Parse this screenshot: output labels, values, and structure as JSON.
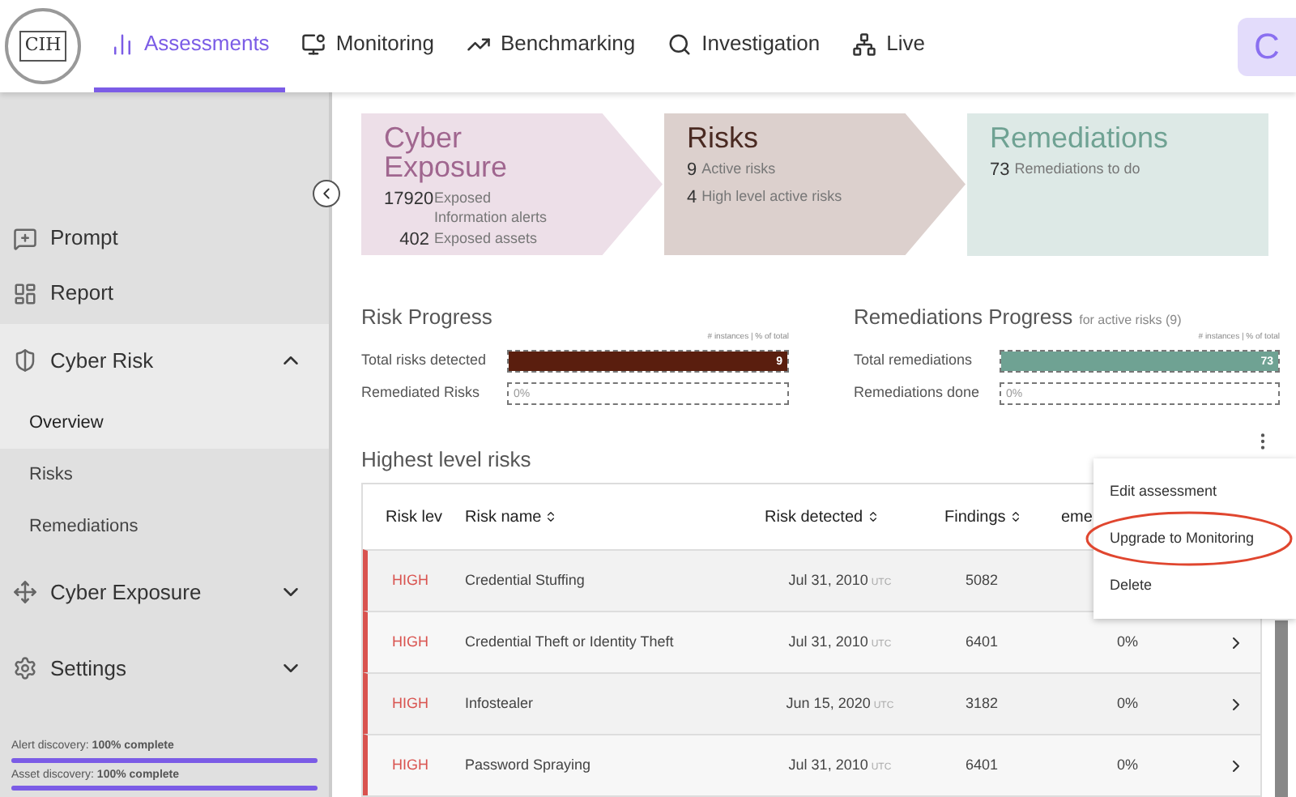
{
  "header": {
    "logo": "CIH",
    "nav": [
      {
        "label": "Assessments",
        "selected": true
      },
      {
        "label": "Monitoring",
        "selected": false
      },
      {
        "label": "Benchmarking",
        "selected": false
      },
      {
        "label": "Investigation",
        "selected": false
      },
      {
        "label": "Live",
        "selected": false
      }
    ],
    "avatar": "C"
  },
  "sidebar": {
    "items": [
      {
        "kind": "item",
        "label": "Prompt"
      },
      {
        "kind": "item",
        "label": "Report"
      },
      {
        "kind": "group",
        "label": "Cyber Risk",
        "expanded": true,
        "children": [
          {
            "label": "Overview",
            "selected": true
          },
          {
            "label": "Risks",
            "selected": false
          },
          {
            "label": "Remediations",
            "selected": false
          }
        ]
      },
      {
        "kind": "group",
        "label": "Cyber Exposure",
        "expanded": false
      },
      {
        "kind": "group",
        "label": "Settings",
        "expanded": false
      }
    ],
    "discovery": [
      {
        "text": "Alert discovery: **100% complete**",
        "level": 1
      },
      {
        "text": "Asset discovery: **100% complete**",
        "level": 1
      }
    ]
  },
  "summary": [
    {
      "title": "Cyber Exposure",
      "stats": [
        {
          "number": "17920",
          "label": "Exposed Information alerts"
        },
        {
          "number": "402",
          "label": "Exposed assets"
        }
      ]
    },
    {
      "title": "Risks",
      "stats": [
        {
          "number": "9",
          "label": "Active risks"
        },
        {
          "number": "4",
          "label": "High level active risks"
        }
      ]
    },
    {
      "title": "Remediations",
      "stats": [
        {
          "number": "73",
          "label": "Remediations to do"
        }
      ]
    }
  ],
  "progress": [
    {
      "title": "Risk Progress",
      "caption": "# instances | % of total",
      "rows": [
        {
          "label": "Total risks detected",
          "level": 1,
          "reading": "9"
        },
        {
          "label": "Remediated Risks",
          "level": 0,
          "reading": "0%"
        }
      ]
    },
    {
      "title": "Remediations Progress",
      "subtitle": "for active risks (9)",
      "caption": "# instances | % of total",
      "rows": [
        {
          "label": "Total remediations",
          "level": 1,
          "reading": "73"
        },
        {
          "label": "Remediations done",
          "level": 0,
          "reading": "0%"
        }
      ]
    }
  ],
  "table": {
    "title": "Highest level risks",
    "columns": [
      {
        "label": "Risk lev",
        "sortable": false
      },
      {
        "label": "Risk name",
        "sortable": true
      },
      {
        "label": "Risk detected",
        "sortable": true
      },
      {
        "label": "Findings",
        "sortable": true
      },
      {
        "label": "eme",
        "sortable": false
      }
    ],
    "rows": [
      {
        "level": "HIGH",
        "name": "Credential Stuffing",
        "date": "Jul 31, 2010",
        "tz": "UTC",
        "findings": "5082"
      },
      {
        "level": "HIGH",
        "name": "Credential Theft or Identity Theft",
        "date": "Jul 31, 2010",
        "tz": "UTC",
        "findings": "6401",
        "remediation": "0%"
      },
      {
        "level": "HIGH",
        "name": "Infostealer",
        "date": "Jun 15, 2020",
        "tz": "UTC",
        "findings": "3182",
        "remediation": "0%"
      },
      {
        "level": "HIGH",
        "name": "Password Spraying",
        "date": "Jul 31, 2010",
        "tz": "UTC",
        "findings": "6401",
        "remediation": "0%"
      }
    ]
  },
  "menu": {
    "items": [
      {
        "label": "Edit assessment",
        "circled": false
      },
      {
        "label": "Upgrade to Monitoring",
        "circled": true
      },
      {
        "label": "Delete",
        "circled": false
      }
    ]
  }
}
